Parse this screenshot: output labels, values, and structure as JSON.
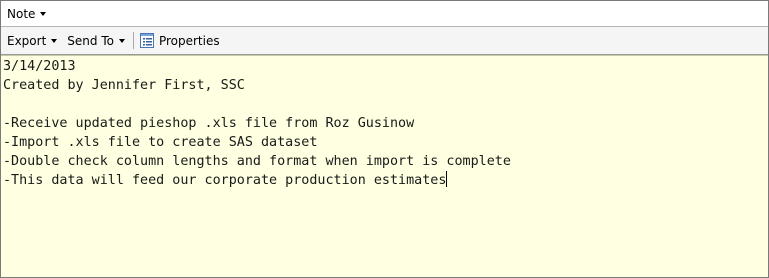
{
  "titlebar": {
    "note_label": "Note"
  },
  "toolbar": {
    "export_label": "Export",
    "sendto_label": "Send To",
    "properties_label": "Properties"
  },
  "icons": {
    "dropdown": "chevron-down-icon",
    "properties": "properties-icon"
  },
  "note": {
    "lines": [
      "3/14/2013",
      "Created by Jennifer First, SSC",
      "",
      "-Receive updated pieshop .xls file from Roz Gusinow",
      "-Import .xls file to create SAS dataset",
      "-Double check column lengths and format when import is complete",
      "-This data will feed our corporate production estimates"
    ]
  },
  "colors": {
    "editor_background": "#ffffe1",
    "toolbar_background": "#f5f5f5"
  }
}
